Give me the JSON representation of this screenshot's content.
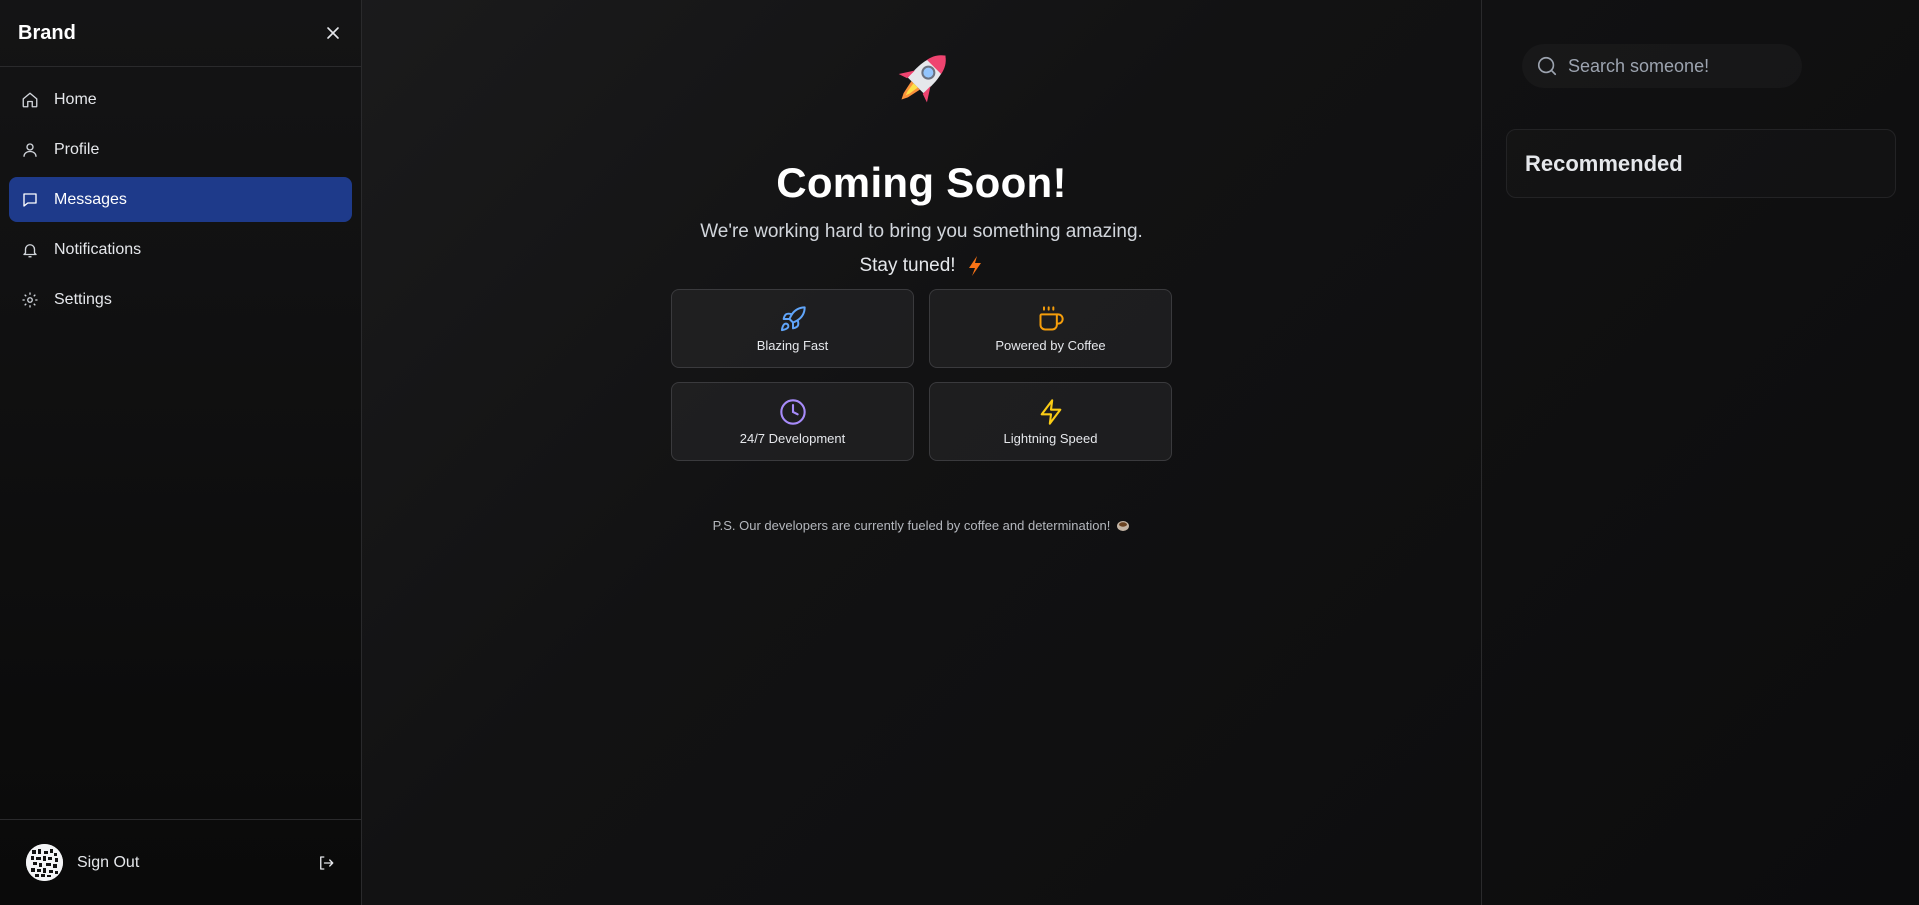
{
  "sidebar": {
    "brand": "Brand",
    "items": [
      {
        "label": "Home",
        "icon": "home-icon",
        "active": false
      },
      {
        "label": "Profile",
        "icon": "user-icon",
        "active": false
      },
      {
        "label": "Messages",
        "icon": "message-icon",
        "active": true
      },
      {
        "label": "Notifications",
        "icon": "bell-icon",
        "active": false
      },
      {
        "label": "Settings",
        "icon": "gear-icon",
        "active": false
      }
    ],
    "footer": {
      "signout_label": "Sign Out"
    }
  },
  "main": {
    "title": "Coming Soon!",
    "subtitle": "We're working hard to bring you something amazing.",
    "tuned": "Stay tuned!",
    "features": [
      {
        "label": "Blazing Fast",
        "icon": "rocket-icon",
        "color": "#60a5fa"
      },
      {
        "label": "Powered by Coffee",
        "icon": "coffee-icon",
        "color": "#f59e0b"
      },
      {
        "label": "24/7 Development",
        "icon": "clock-icon",
        "color": "#a78bfa"
      },
      {
        "label": "Lightning Speed",
        "icon": "lightning-icon",
        "color": "#facc15"
      }
    ],
    "ps": "P.S. Our developers are currently fueled by coffee and determination!"
  },
  "right": {
    "search_placeholder": "Search someone!",
    "recommended_title": "Recommended"
  },
  "colors": {
    "active_nav": "#1e3a8a",
    "background": "#121213"
  }
}
